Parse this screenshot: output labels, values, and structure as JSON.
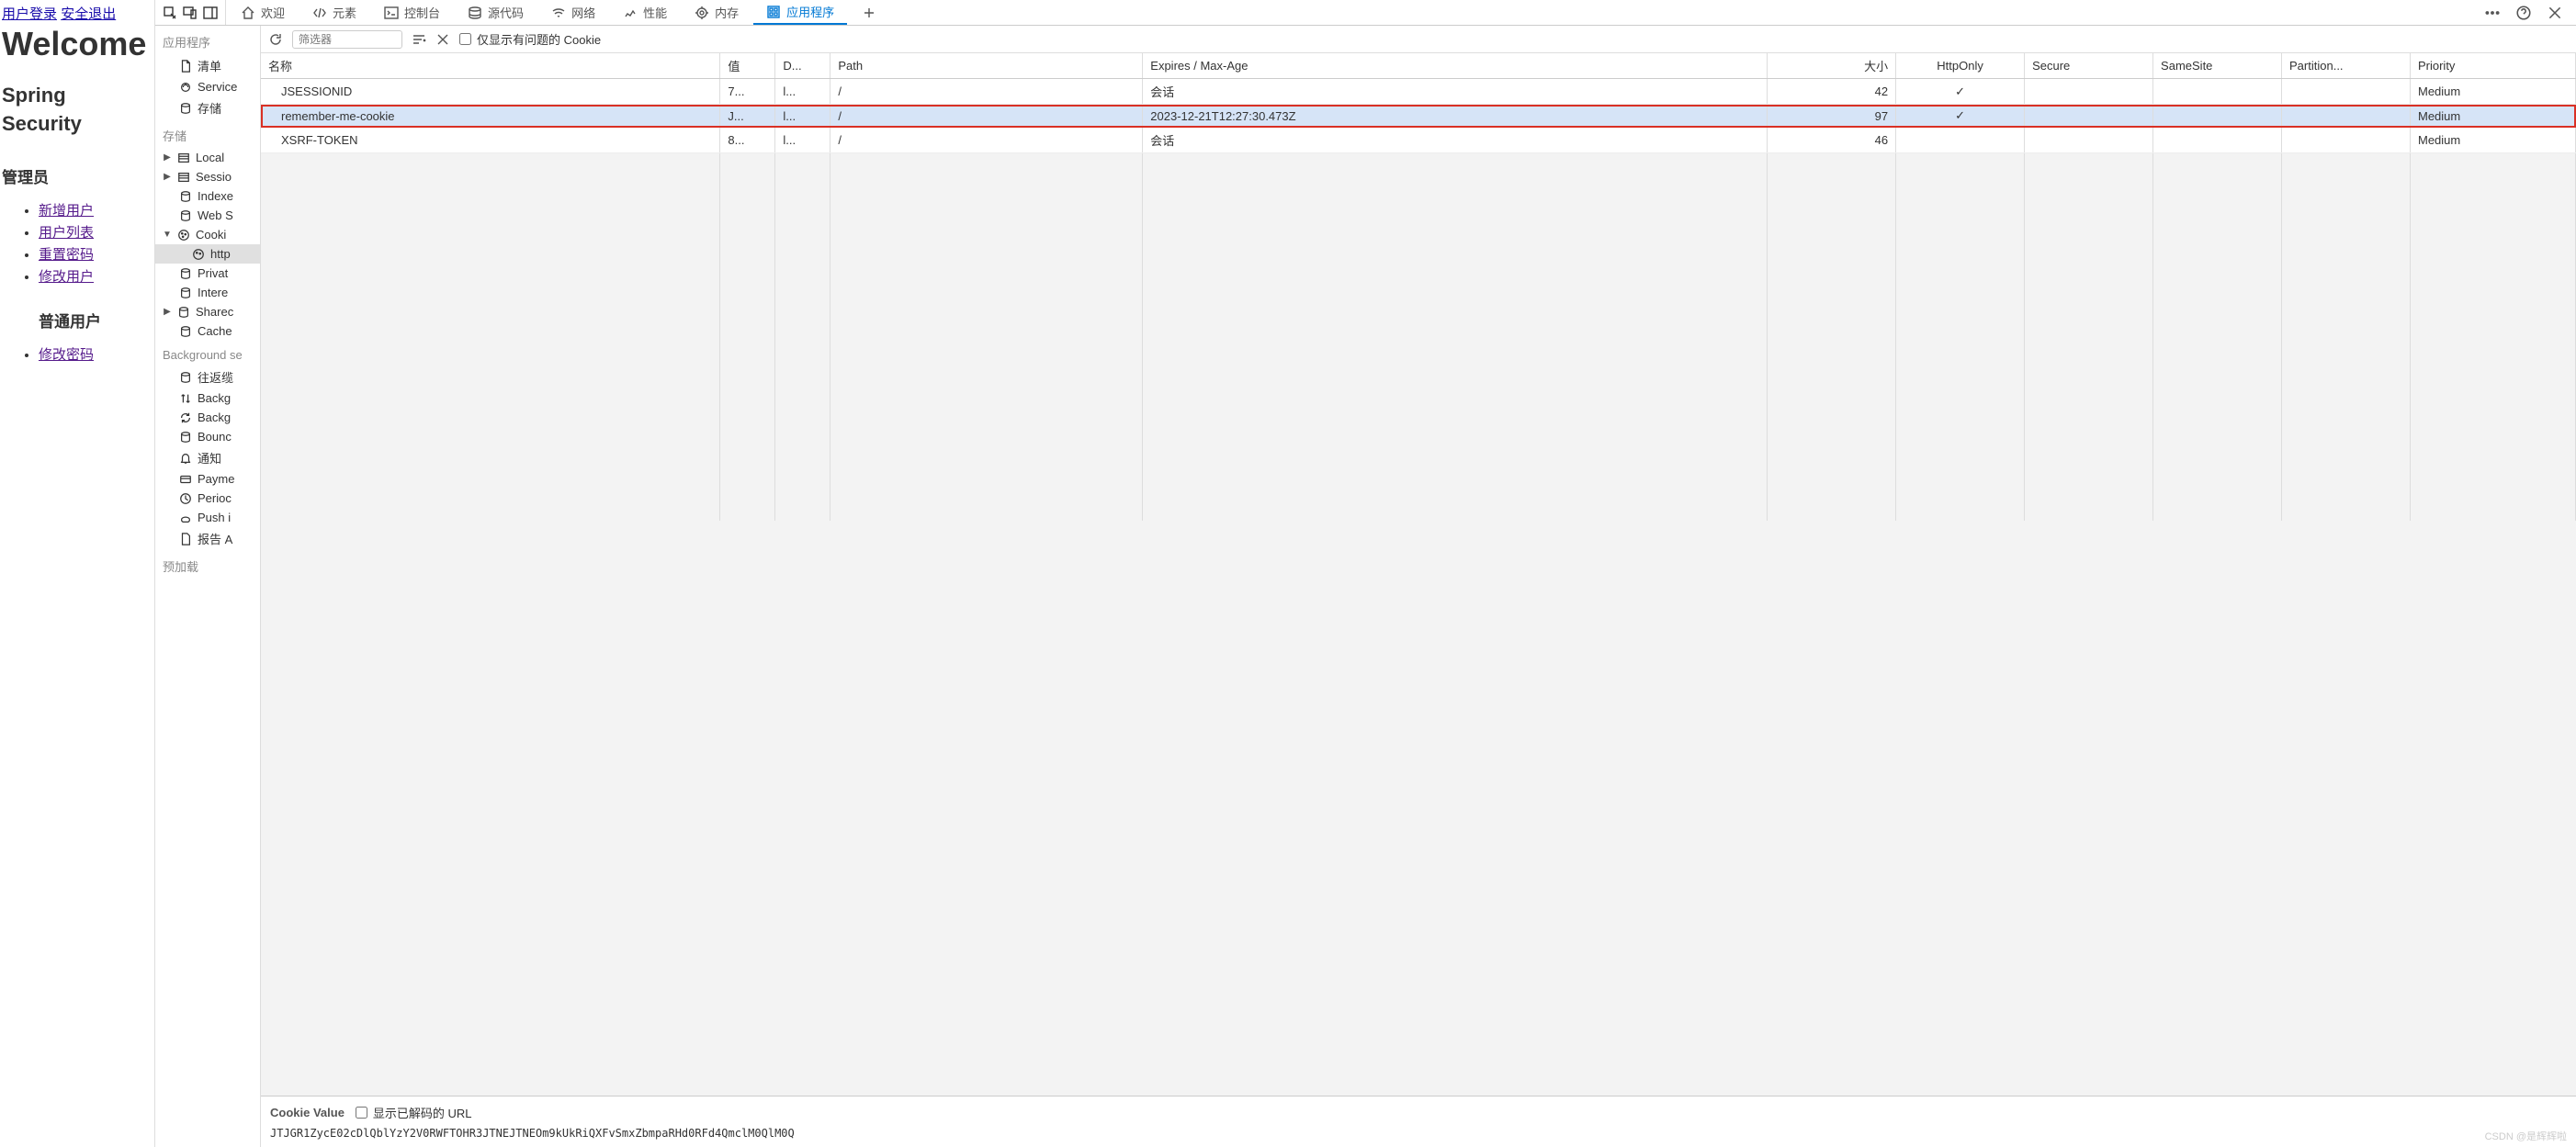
{
  "webpage": {
    "login_link": "用户登录",
    "logout_link": "安全退出",
    "welcome": "Welcome",
    "title_line1": "Spring",
    "title_line2": "Security",
    "admin_heading": "管理员",
    "admin_links": [
      "新增用户",
      "用户列表",
      "重置密码",
      "修改用户"
    ],
    "user_heading": "普通用户",
    "user_links": [
      "修改密码"
    ]
  },
  "tabs": {
    "welcome": "欢迎",
    "elements": "元素",
    "console": "控制台",
    "sources": "源代码",
    "network": "网络",
    "performance": "性能",
    "memory": "内存",
    "application": "应用程序"
  },
  "sidebar": {
    "app_section": "应用程序",
    "manifest": "清单",
    "service": "Service",
    "storage": "存储",
    "storage_section": "存储",
    "local": "Local",
    "session": "Sessio",
    "indexed": "Indexe",
    "websql": "Web S",
    "cookies": "Cooki",
    "cookie_child": "http",
    "private": "Privat",
    "interest": "Intere",
    "shared": "Sharec",
    "cache": "Cache",
    "bg_section": "Background se",
    "bg_fetch": "往返缆",
    "bg_sync1": "Backg",
    "bg_sync2": "Backg",
    "bounce": "Bounc",
    "notif": "通知",
    "payment": "Payme",
    "periodic": "Perioc",
    "push": "Push i",
    "report": "报告 A",
    "preload_section": "预加载"
  },
  "toolbar": {
    "filter_placeholder": "筛选器",
    "show_issues": "仅显示有问题的 Cookie"
  },
  "table": {
    "headers": {
      "name": "名称",
      "value": "值",
      "domain": "D...",
      "path": "Path",
      "expires": "Expires / Max-Age",
      "size": "大小",
      "httponly": "HttpOnly",
      "secure": "Secure",
      "samesite": "SameSite",
      "partition": "Partition...",
      "priority": "Priority"
    },
    "rows": [
      {
        "name": "JSESSIONID",
        "value": "7...",
        "domain": "l...",
        "path": "/",
        "expires": "会话",
        "size": "42",
        "httponly": "✓",
        "secure": "",
        "samesite": "",
        "partition": "",
        "priority": "Medium",
        "hl": false
      },
      {
        "name": "remember-me-cookie",
        "value": "J...",
        "domain": "l...",
        "path": "/",
        "expires": "2023-12-21T12:27:30.473Z",
        "size": "97",
        "httponly": "✓",
        "secure": "",
        "samesite": "",
        "partition": "",
        "priority": "Medium",
        "hl": true
      },
      {
        "name": "XSRF-TOKEN",
        "value": "8...",
        "domain": "l...",
        "path": "/",
        "expires": "会话",
        "size": "46",
        "httponly": "",
        "secure": "",
        "samesite": "",
        "partition": "",
        "priority": "Medium",
        "hl": false
      }
    ]
  },
  "detail": {
    "label": "Cookie Value",
    "decoded": "显示已解码的 URL",
    "value": "JTJGR1ZycE02cDlQblYzY2V0RWFTOHR3JTNEJTNEOm9kUkRiQXFvSmxZbmpaRHd0RFd4QmclM0QlM0Q"
  },
  "watermark": "CSDN @是辉辉啦"
}
